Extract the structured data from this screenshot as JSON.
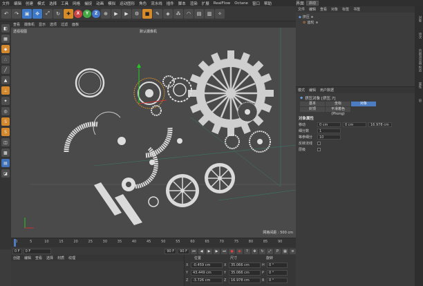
{
  "menubar": {
    "items": [
      "文件",
      "编辑",
      "创建",
      "模式",
      "选择",
      "工具",
      "网格",
      "捕捉",
      "动画",
      "模拟",
      "运动图形",
      "角色",
      "流水线",
      "插件",
      "脚本",
      "渲染",
      "扩展",
      "RealFlow",
      "Octane",
      "窗口",
      "帮助"
    ],
    "layout_label": "界面",
    "layout_value": "启动"
  },
  "toptoolbar": {
    "icons": [
      "undo-icon",
      "redo-icon",
      "select-icon",
      "move-icon",
      "scale-icon",
      "rotate-icon",
      "recent-icon",
      "x-axis",
      "y-axis",
      "z-axis",
      "world-icon",
      "render-view-icon",
      "render-icon",
      "render-settings-icon",
      "cube-icon",
      "pen-icon",
      "subdivide-icon",
      "array-icon",
      "deformer-icon",
      "scene-icon",
      "camera-icon",
      "light-icon"
    ],
    "xyz": [
      "X",
      "Y",
      "Z"
    ]
  },
  "viewport": {
    "menu": [
      "查看",
      "摄像机",
      "显示",
      "选项",
      "过滤",
      "面板"
    ],
    "view_name": "透视视图",
    "camera_label": "默认摄像机",
    "grid_distance": "网格间距 : 500 cm"
  },
  "timeline": {
    "ticks": [
      "0",
      "5",
      "10",
      "15",
      "20",
      "25",
      "30",
      "35",
      "40",
      "45",
      "50",
      "55",
      "60",
      "65",
      "70",
      "75",
      "80",
      "85",
      "90"
    ],
    "current_frame": "0 F",
    "start": "0 F",
    "end": "90 F",
    "end2": "90 F"
  },
  "material_menu": [
    "创建",
    "编辑",
    "查看",
    "选择",
    "材质",
    "纹理"
  ],
  "coords": {
    "headers": [
      "位置",
      "尺寸",
      "旋转"
    ],
    "rows": [
      {
        "axis": "X",
        "pos": "-0.459 cm",
        "size_axis": "X",
        "size": "35.066 cm",
        "rot_axis": "H",
        "rot": "0 °"
      },
      {
        "axis": "Y",
        "pos": "43.449 cm",
        "size_axis": "Y",
        "size": "35.066 cm",
        "rot_axis": "P",
        "rot": "0 °"
      },
      {
        "axis": "Z",
        "pos": "-3.726 cm",
        "size_axis": "Z",
        "size": "16.978 cm",
        "rot_axis": "B",
        "rot": "0 °"
      }
    ]
  },
  "object_manager": {
    "menu": [
      "文件",
      "编辑",
      "查看",
      "对象",
      "标签",
      "书签"
    ],
    "objects": [
      "挤压",
      "齿轮"
    ]
  },
  "attributes": {
    "menu": [
      "模式",
      "编辑",
      "用户数据"
    ],
    "title": "挤压对象 [挤压.7]",
    "tabs": [
      "基本",
      "坐标",
      "对象",
      "封顶",
      "平滑着色(Phong)"
    ],
    "section": "对象属性",
    "props": [
      {
        "label": "移动",
        "v1": "0 cm",
        "v2": "0 cm",
        "v3": "16.978 cm"
      },
      {
        "label": "细分数",
        "v1": "1"
      },
      {
        "label": "等参细分",
        "v1": "10"
      },
      {
        "label": "反转法线"
      },
      {
        "label": "层级"
      }
    ]
  },
  "side_tabs": [
    "对象",
    "场次",
    "内容浏览器",
    "构造",
    "属性",
    "层"
  ],
  "colors": {
    "accent": "#4c7cc1",
    "toolbar_orange": "#d68b2a"
  }
}
